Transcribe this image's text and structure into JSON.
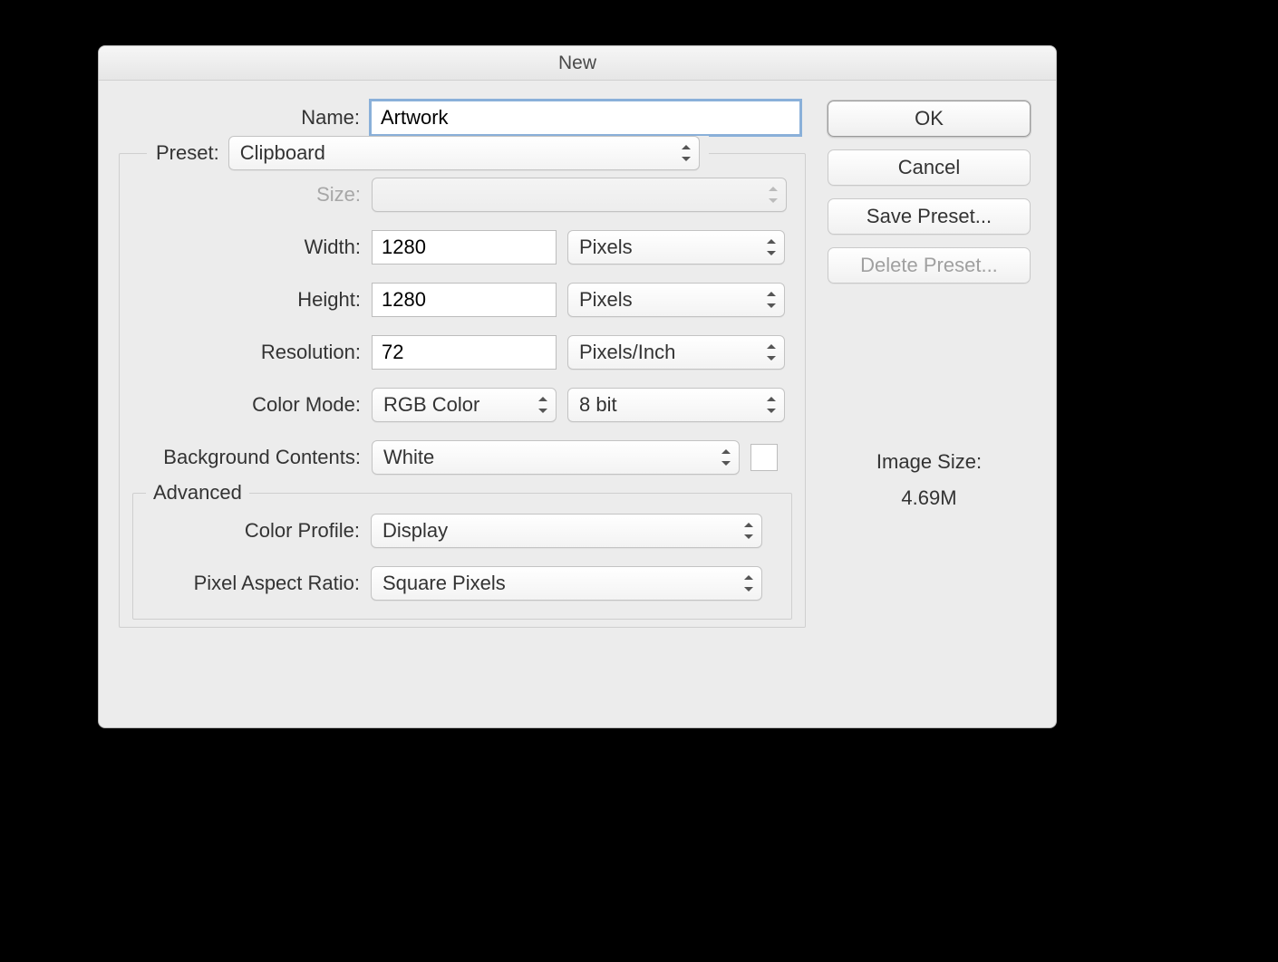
{
  "dialog": {
    "title": "New"
  },
  "labels": {
    "name": "Name:",
    "preset": "Preset:",
    "size": "Size:",
    "width": "Width:",
    "height": "Height:",
    "resolution": "Resolution:",
    "color_mode": "Color Mode:",
    "background_contents": "Background Contents:",
    "advanced": "Advanced",
    "color_profile": "Color Profile:",
    "pixel_aspect_ratio": "Pixel Aspect Ratio:",
    "image_size": "Image Size:"
  },
  "fields": {
    "name_value": "Artwork",
    "preset_value": "Clipboard",
    "size_value": "",
    "width_value": "1280",
    "width_unit": "Pixels",
    "height_value": "1280",
    "height_unit": "Pixels",
    "resolution_value": "72",
    "resolution_unit": "Pixels/Inch",
    "color_mode_value": "RGB Color",
    "color_depth_value": "8 bit",
    "background_contents_value": "White",
    "color_profile_value": "Display",
    "pixel_aspect_ratio_value": "Square Pixels"
  },
  "buttons": {
    "ok": "OK",
    "cancel": "Cancel",
    "save_preset": "Save Preset...",
    "delete_preset": "Delete Preset..."
  },
  "info": {
    "image_size_value": "4.69M"
  }
}
